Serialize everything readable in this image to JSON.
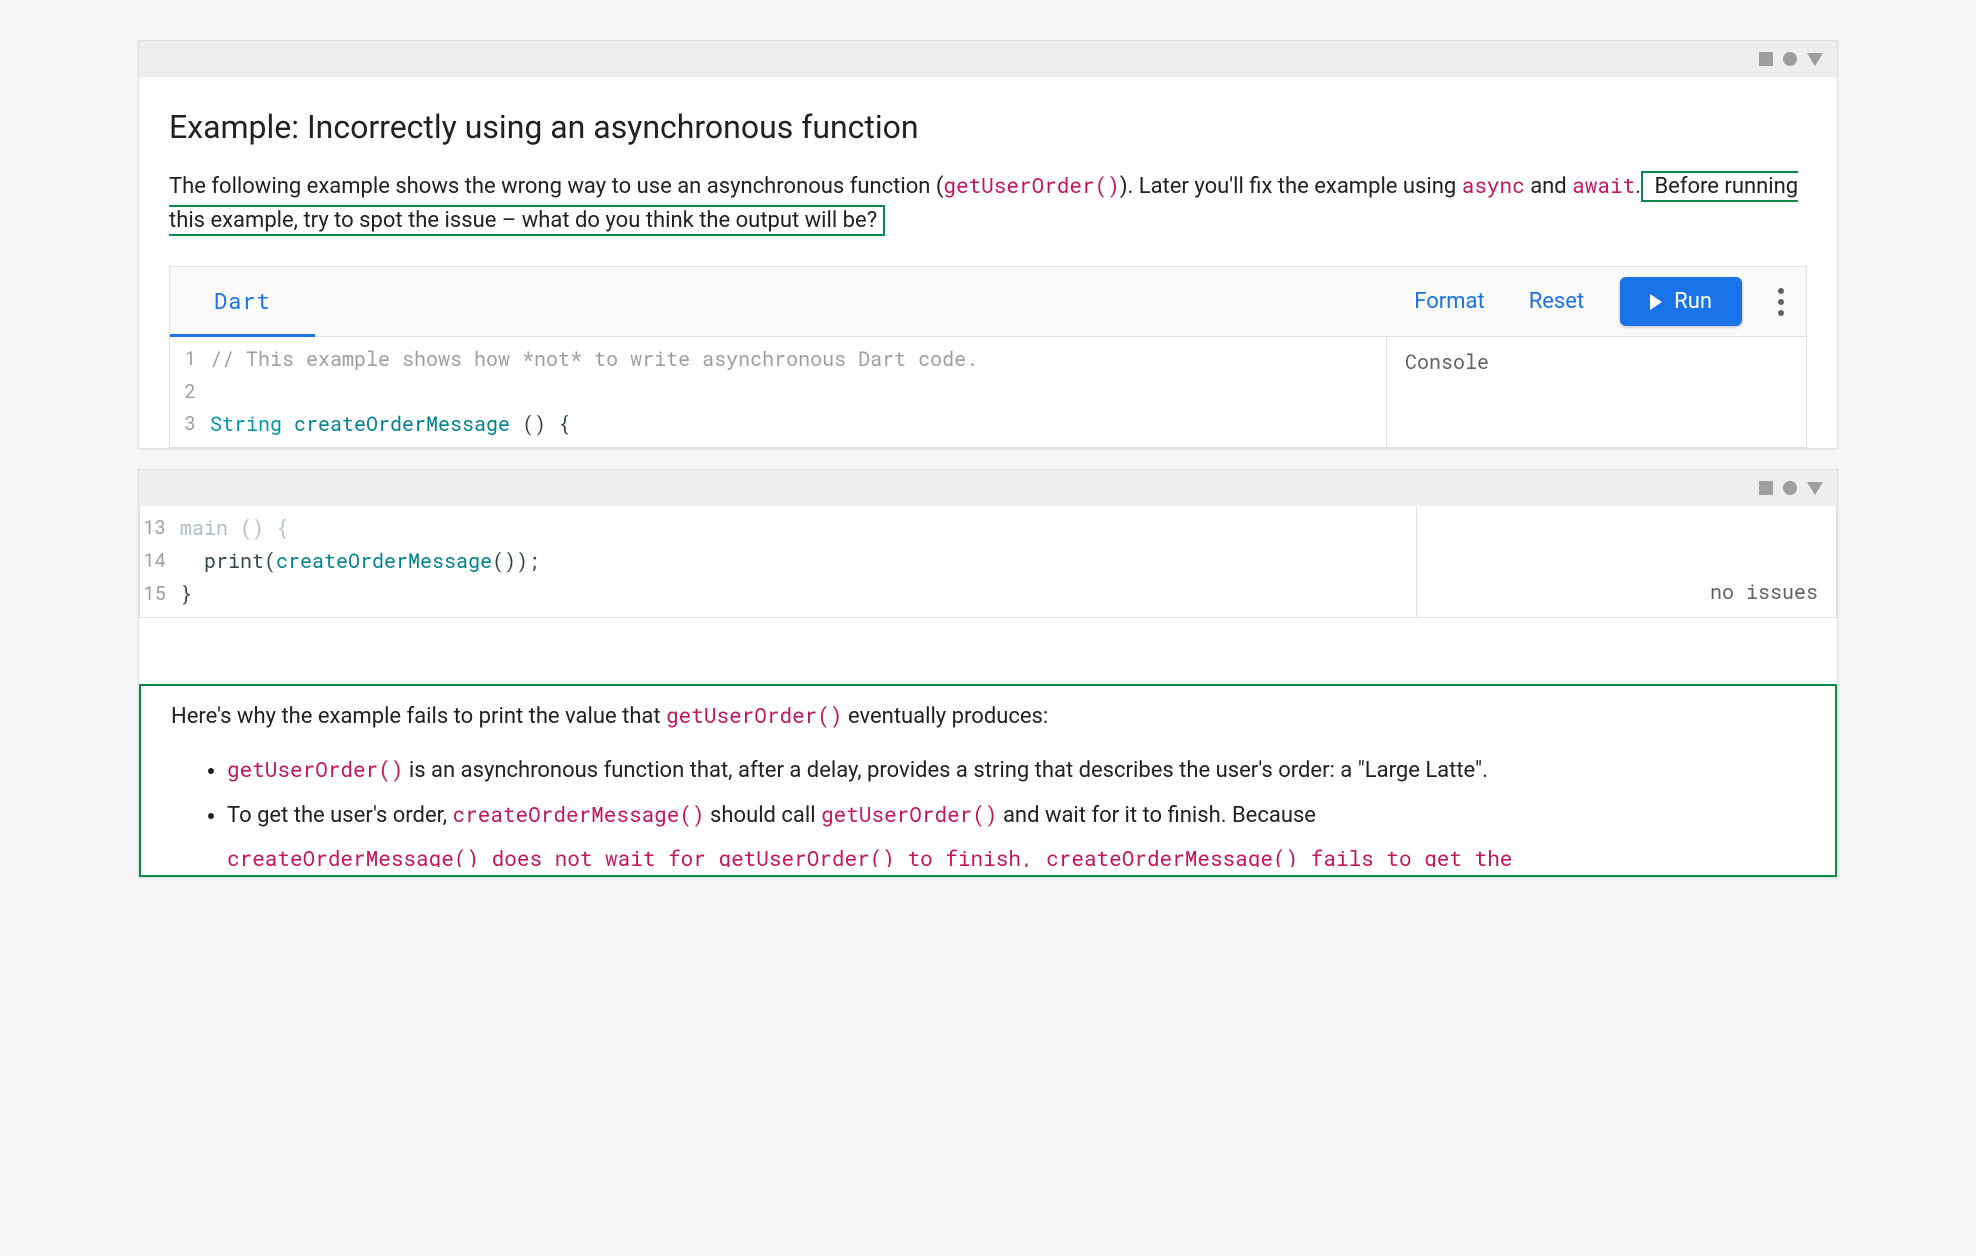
{
  "heading": "Example: Incorrectly using an asynchronous function",
  "intro": {
    "part1": "The following example shows the wrong way to use an asynchronous function (",
    "code1": "getUserOrder()",
    "part2": "). Later you'll fix the example using ",
    "code2": "async",
    "part3": " and ",
    "code3": "await",
    "part4": ".",
    "boxed": " Before running this example, try to spot the issue – what do you think the output will be? "
  },
  "dartpad": {
    "tab": "Dart",
    "format": "Format",
    "reset": "Reset",
    "run": "Run",
    "console_label": "Console",
    "no_issues": "no issues"
  },
  "code_top": [
    {
      "n": "1",
      "tokens": [
        [
          "comment",
          "// This example shows how *not* to write asynchronous Dart code."
        ]
      ]
    },
    {
      "n": "2",
      "tokens": []
    },
    {
      "n": "3",
      "tokens": [
        [
          "type",
          "String "
        ],
        [
          "ident",
          "createOrderMessage "
        ],
        [
          "plain",
          "() {"
        ]
      ]
    }
  ],
  "code_bottom": [
    {
      "n": "13",
      "tokens": [
        [
          "faded",
          "main "
        ],
        [
          "faded",
          "() {"
        ]
      ]
    },
    {
      "n": "14",
      "tokens": [
        [
          "plain",
          "  print"
        ],
        [
          "plain",
          "("
        ],
        [
          "ident",
          "createOrderMessage"
        ],
        [
          "plain",
          "());"
        ]
      ]
    },
    {
      "n": "15",
      "tokens": [
        [
          "plain",
          "}"
        ]
      ]
    }
  ],
  "explain": {
    "lead_a": "Here's why the example fails to print the value that ",
    "lead_code": "getUserOrder()",
    "lead_b": " eventually produces:",
    "bullet1_code": "getUserOrder()",
    "bullet1_rest": " is an asynchronous function that, after a delay, provides a string that describes the user's order: a \"Large Latte\".",
    "bullet2_a": "To get the user's order, ",
    "bullet2_code1": "createOrderMessage()",
    "bullet2_b": " should call ",
    "bullet2_code2": "getUserOrder()",
    "bullet2_c": " and wait for it to finish. Because ",
    "cutoff": "createOrderMessage() does not wait for getUserOrder() to finish, createOrderMessage() fails to get the"
  }
}
